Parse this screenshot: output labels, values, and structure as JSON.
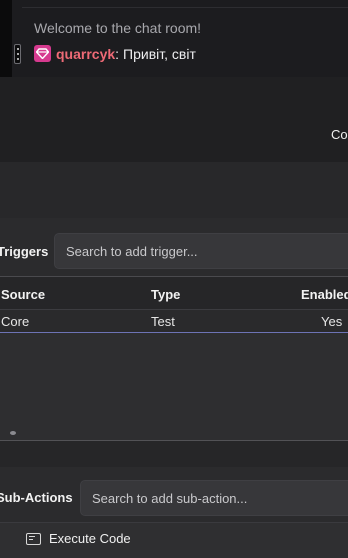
{
  "chat": {
    "welcome": "Welcome to the chat room!",
    "message": {
      "user": "quarrcyk",
      "separator": ":",
      "text": "Привіт, світ"
    }
  },
  "header": {
    "partial_label": "Co"
  },
  "triggers": {
    "label": "Triggers",
    "search_placeholder": "Search to add trigger...",
    "columns": [
      "Source",
      "Type",
      "Enabled"
    ],
    "rows": [
      {
        "source": "Core",
        "type": "Test",
        "enabled": "Yes"
      }
    ]
  },
  "sub_actions": {
    "label": "Sub-Actions",
    "search_placeholder": "Search to add sub-action...",
    "items": [
      {
        "label": "Execute Code",
        "icon": "code-window-icon"
      }
    ]
  },
  "colors": {
    "username": "#ee6a76",
    "badge": "#d63a8f",
    "selection_border": "#6d73b5"
  }
}
